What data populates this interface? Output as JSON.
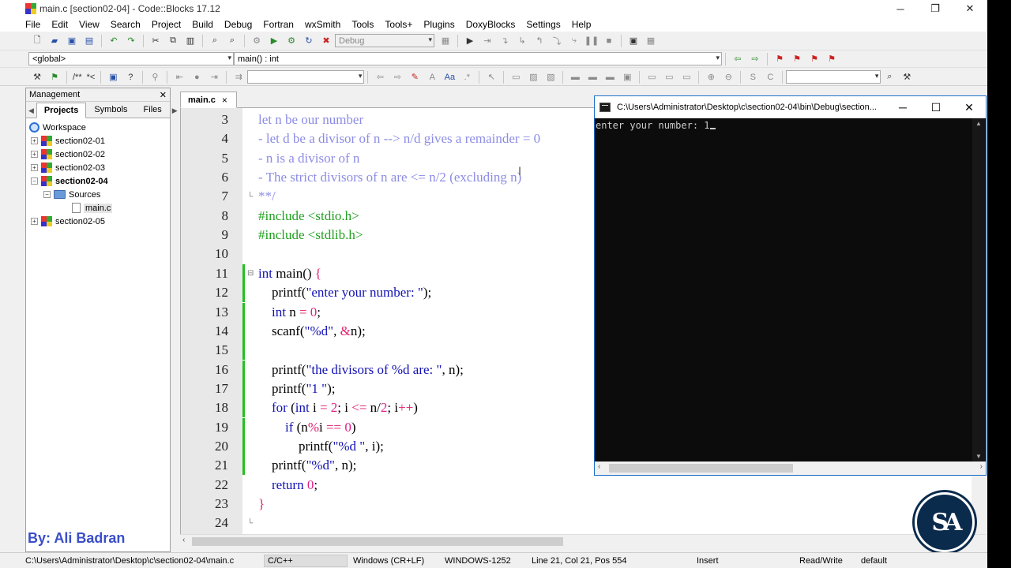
{
  "window": {
    "title": "main.c [section02-04] - Code::Blocks 17.12"
  },
  "menu": [
    "File",
    "Edit",
    "View",
    "Search",
    "Project",
    "Build",
    "Debug",
    "Fortran",
    "wxSmith",
    "Tools",
    "Tools+",
    "Plugins",
    "DoxyBlocks",
    "Settings",
    "Help"
  ],
  "toolbar": {
    "build_target": "Debug",
    "scope": "<global>",
    "function": "main() : int",
    "comment_button": "/**",
    "comment_button2": "*<"
  },
  "management": {
    "title": "Management",
    "tabs": [
      "Projects",
      "Symbols",
      "Files"
    ],
    "active_tab": "Projects",
    "workspace": "Workspace",
    "projects": [
      "section02-01",
      "section02-02",
      "section02-03",
      "section02-04",
      "section02-05"
    ],
    "active_project": "section02-04",
    "sources_folder": "Sources",
    "source_file": "main.c"
  },
  "editor": {
    "tab_label": "main.c",
    "tab_close": "×",
    "lines": [
      {
        "n": "3",
        "text": "let n be our number",
        "kind": "comment"
      },
      {
        "n": "4",
        "text": "- let d be a divisor of n --> n/d gives a remainder = 0",
        "kind": "comment"
      },
      {
        "n": "5",
        "text": "- n is a divisor of n",
        "kind": "comment"
      },
      {
        "n": "6",
        "text": "- The strict divisors of n are <= n/2 (excluding n)",
        "kind": "comment"
      },
      {
        "n": "7",
        "text": "**/",
        "kind": "comment"
      },
      {
        "n": "8",
        "text": "#include <stdio.h>",
        "kind": "pre"
      },
      {
        "n": "9",
        "text": "#include <stdlib.h>",
        "kind": "pre"
      },
      {
        "n": "10",
        "text": "",
        "kind": "plain"
      },
      {
        "n": "11",
        "text": "int main() {",
        "kind": "code"
      },
      {
        "n": "12",
        "text": "    printf(\"enter your number: \");",
        "kind": "code"
      },
      {
        "n": "13",
        "text": "    int n = 0;",
        "kind": "code"
      },
      {
        "n": "14",
        "text": "    scanf(\"%d\", &n);",
        "kind": "code"
      },
      {
        "n": "15",
        "text": "",
        "kind": "plain"
      },
      {
        "n": "16",
        "text": "    printf(\"the divisors of %d are: \", n);",
        "kind": "code"
      },
      {
        "n": "17",
        "text": "    printf(\"1 \");",
        "kind": "code"
      },
      {
        "n": "18",
        "text": "    for (int i = 2; i <= n/2; i++)",
        "kind": "code"
      },
      {
        "n": "19",
        "text": "        if (n%i == 0)",
        "kind": "code"
      },
      {
        "n": "20",
        "text": "            printf(\"%d \", i);",
        "kind": "code"
      },
      {
        "n": "21",
        "text": "    printf(\"%d\", n);",
        "kind": "code"
      },
      {
        "n": "22",
        "text": "    return 0;",
        "kind": "code"
      },
      {
        "n": "23",
        "text": "}",
        "kind": "code"
      },
      {
        "n": "24",
        "text": "",
        "kind": "plain"
      }
    ]
  },
  "console": {
    "title": "C:\\Users\\Administrator\\Desktop\\c\\section02-04\\bin\\Debug\\section...",
    "prompt": "enter your number: ",
    "input": "1"
  },
  "watermark": "By: Ali Badran",
  "logo_text": "SA",
  "statusbar": {
    "path": "C:\\Users\\Administrator\\Desktop\\c\\section02-04\\main.c",
    "language": "C/C++",
    "line_endings": "Windows (CR+LF)",
    "encoding": "WINDOWS-1252",
    "position": "Line 21, Col 21, Pos 554",
    "mode": "Insert",
    "access": "Read/Write",
    "profile": "default"
  },
  "colors": {
    "comment": "#8c8ce6",
    "preprocessor": "#22a022",
    "keyword": "#1212b4",
    "number": "#e0208c",
    "change_bar": "#22c022",
    "console_bg": "#0c0c0c",
    "watermark": "#3a4ec8"
  }
}
